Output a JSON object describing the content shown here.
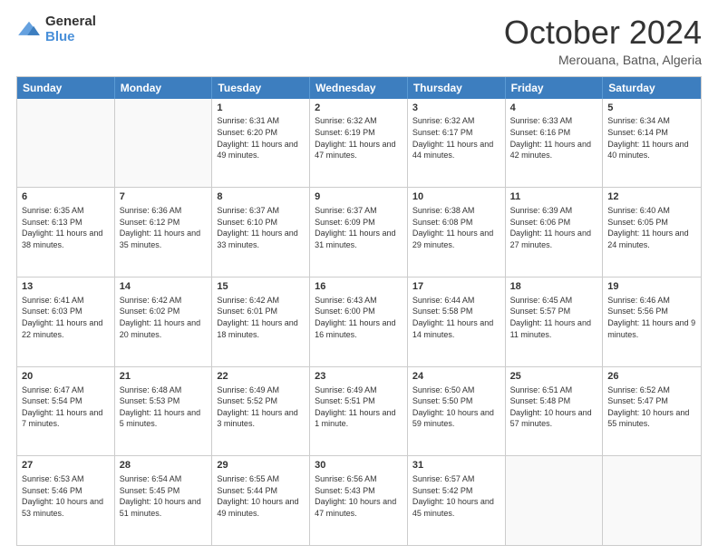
{
  "logo": {
    "line1": "General",
    "line2": "Blue"
  },
  "title": "October 2024",
  "location": "Merouana, Batna, Algeria",
  "days_of_week": [
    "Sunday",
    "Monday",
    "Tuesday",
    "Wednesday",
    "Thursday",
    "Friday",
    "Saturday"
  ],
  "weeks": [
    [
      {
        "day": "",
        "content": ""
      },
      {
        "day": "",
        "content": ""
      },
      {
        "day": "1",
        "content": "Sunrise: 6:31 AM\nSunset: 6:20 PM\nDaylight: 11 hours and 49 minutes."
      },
      {
        "day": "2",
        "content": "Sunrise: 6:32 AM\nSunset: 6:19 PM\nDaylight: 11 hours and 47 minutes."
      },
      {
        "day": "3",
        "content": "Sunrise: 6:32 AM\nSunset: 6:17 PM\nDaylight: 11 hours and 44 minutes."
      },
      {
        "day": "4",
        "content": "Sunrise: 6:33 AM\nSunset: 6:16 PM\nDaylight: 11 hours and 42 minutes."
      },
      {
        "day": "5",
        "content": "Sunrise: 6:34 AM\nSunset: 6:14 PM\nDaylight: 11 hours and 40 minutes."
      }
    ],
    [
      {
        "day": "6",
        "content": "Sunrise: 6:35 AM\nSunset: 6:13 PM\nDaylight: 11 hours and 38 minutes."
      },
      {
        "day": "7",
        "content": "Sunrise: 6:36 AM\nSunset: 6:12 PM\nDaylight: 11 hours and 35 minutes."
      },
      {
        "day": "8",
        "content": "Sunrise: 6:37 AM\nSunset: 6:10 PM\nDaylight: 11 hours and 33 minutes."
      },
      {
        "day": "9",
        "content": "Sunrise: 6:37 AM\nSunset: 6:09 PM\nDaylight: 11 hours and 31 minutes."
      },
      {
        "day": "10",
        "content": "Sunrise: 6:38 AM\nSunset: 6:08 PM\nDaylight: 11 hours and 29 minutes."
      },
      {
        "day": "11",
        "content": "Sunrise: 6:39 AM\nSunset: 6:06 PM\nDaylight: 11 hours and 27 minutes."
      },
      {
        "day": "12",
        "content": "Sunrise: 6:40 AM\nSunset: 6:05 PM\nDaylight: 11 hours and 24 minutes."
      }
    ],
    [
      {
        "day": "13",
        "content": "Sunrise: 6:41 AM\nSunset: 6:03 PM\nDaylight: 11 hours and 22 minutes."
      },
      {
        "day": "14",
        "content": "Sunrise: 6:42 AM\nSunset: 6:02 PM\nDaylight: 11 hours and 20 minutes."
      },
      {
        "day": "15",
        "content": "Sunrise: 6:42 AM\nSunset: 6:01 PM\nDaylight: 11 hours and 18 minutes."
      },
      {
        "day": "16",
        "content": "Sunrise: 6:43 AM\nSunset: 6:00 PM\nDaylight: 11 hours and 16 minutes."
      },
      {
        "day": "17",
        "content": "Sunrise: 6:44 AM\nSunset: 5:58 PM\nDaylight: 11 hours and 14 minutes."
      },
      {
        "day": "18",
        "content": "Sunrise: 6:45 AM\nSunset: 5:57 PM\nDaylight: 11 hours and 11 minutes."
      },
      {
        "day": "19",
        "content": "Sunrise: 6:46 AM\nSunset: 5:56 PM\nDaylight: 11 hours and 9 minutes."
      }
    ],
    [
      {
        "day": "20",
        "content": "Sunrise: 6:47 AM\nSunset: 5:54 PM\nDaylight: 11 hours and 7 minutes."
      },
      {
        "day": "21",
        "content": "Sunrise: 6:48 AM\nSunset: 5:53 PM\nDaylight: 11 hours and 5 minutes."
      },
      {
        "day": "22",
        "content": "Sunrise: 6:49 AM\nSunset: 5:52 PM\nDaylight: 11 hours and 3 minutes."
      },
      {
        "day": "23",
        "content": "Sunrise: 6:49 AM\nSunset: 5:51 PM\nDaylight: 11 hours and 1 minute."
      },
      {
        "day": "24",
        "content": "Sunrise: 6:50 AM\nSunset: 5:50 PM\nDaylight: 10 hours and 59 minutes."
      },
      {
        "day": "25",
        "content": "Sunrise: 6:51 AM\nSunset: 5:48 PM\nDaylight: 10 hours and 57 minutes."
      },
      {
        "day": "26",
        "content": "Sunrise: 6:52 AM\nSunset: 5:47 PM\nDaylight: 10 hours and 55 minutes."
      }
    ],
    [
      {
        "day": "27",
        "content": "Sunrise: 6:53 AM\nSunset: 5:46 PM\nDaylight: 10 hours and 53 minutes."
      },
      {
        "day": "28",
        "content": "Sunrise: 6:54 AM\nSunset: 5:45 PM\nDaylight: 10 hours and 51 minutes."
      },
      {
        "day": "29",
        "content": "Sunrise: 6:55 AM\nSunset: 5:44 PM\nDaylight: 10 hours and 49 minutes."
      },
      {
        "day": "30",
        "content": "Sunrise: 6:56 AM\nSunset: 5:43 PM\nDaylight: 10 hours and 47 minutes."
      },
      {
        "day": "31",
        "content": "Sunrise: 6:57 AM\nSunset: 5:42 PM\nDaylight: 10 hours and 45 minutes."
      },
      {
        "day": "",
        "content": ""
      },
      {
        "day": "",
        "content": ""
      }
    ]
  ]
}
